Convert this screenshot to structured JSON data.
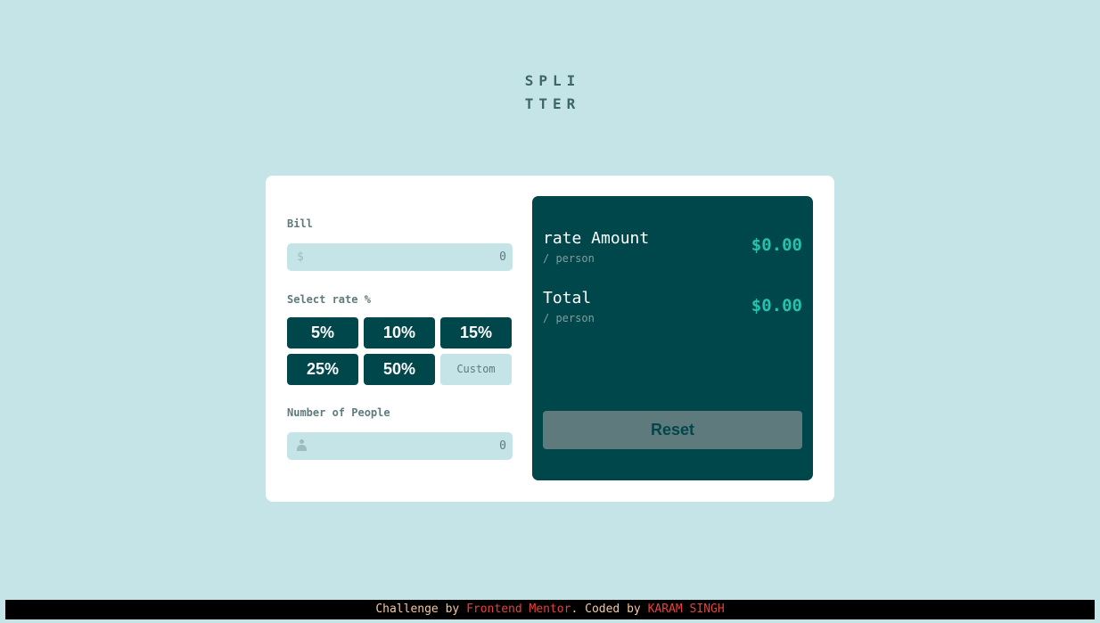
{
  "logo": {
    "line1": "SPLI",
    "line2": "TTER"
  },
  "form": {
    "bill_label": "Bill",
    "bill_icon": "dollar-icon",
    "bill_icon_glyph": "$",
    "bill_value": "0",
    "tip_label": "Select rate %",
    "tips": [
      "5%",
      "10%",
      "15%",
      "25%",
      "50%"
    ],
    "custom_tip": "Custom",
    "people_label": "Number of People",
    "people_icon": "person-icon",
    "people_value": "0"
  },
  "results": {
    "tip_amount": {
      "title": "rate Amount",
      "sub": "/ person",
      "value": "$0.00"
    },
    "total": {
      "title": "Total",
      "sub": "/ person",
      "value": "$0.00"
    },
    "reset_label": "Reset"
  },
  "footer": {
    "challenge_text": "Challenge by",
    "challenge_link": "Frontend Mentor",
    "coded_text": ". Coded by",
    "author_link": "KARAM SINGH"
  },
  "colors": {
    "background": "#c5e4e7",
    "dark_cyan": "#00474b",
    "accent": "#26c2ad",
    "footer_link": "#e7413b",
    "footer_text": "#f4c89e"
  }
}
